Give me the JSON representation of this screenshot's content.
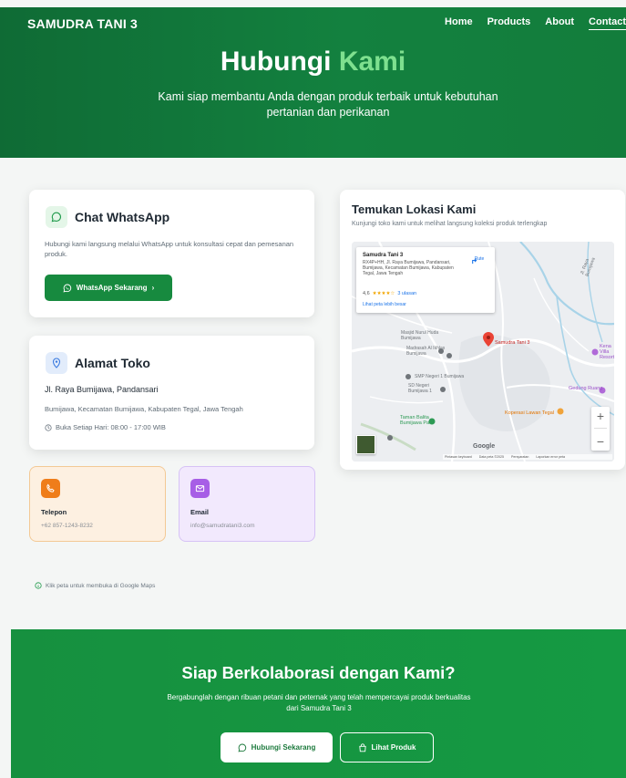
{
  "header": {
    "brand": "SAMUDRA TANI 3",
    "nav": [
      "Home",
      "Products",
      "About",
      "Contact"
    ]
  },
  "hero": {
    "title_main": "Hubungi",
    "title_accent": "Kami",
    "subtitle": "Kami siap membantu Anda dengan produk terbaik untuk kebutuhan pertanian dan perikanan"
  },
  "whatsapp": {
    "title": "Chat WhatsApp",
    "description": "Hubungi kami langsung melalui WhatsApp untuk konsultasi cepat dan pemesanan produk.",
    "button_label": "WhatsApp Sekarang",
    "button_arrow": "›"
  },
  "address": {
    "title": "Alamat Toko",
    "street": "Jl. Raya Bumijawa, Pandansari",
    "region": "Bumijawa, Kecamatan Bumijawa, Kabupaten Tegal, Jawa Tengah",
    "hours": "Buka Setiap Hari: 08:00 - 17:00 WIB"
  },
  "phone": {
    "label": "Telepon",
    "value": "+62 857-1243-8232"
  },
  "email": {
    "label": "Email",
    "value": "info@samudratani3.com"
  },
  "maps_hint": "Klik peta untuk membuka di Google Maps",
  "map_card": {
    "title": "Temukan Lokasi Kami",
    "subtitle": "Kunjungi toko kami untuk melihat langsung koleksi produk terlengkap",
    "popup": {
      "name": "Samudra Tani 3",
      "address": "RX4P+HH, Jl. Raya Bumijawa, Pandansari, Bumijawa, Kecamatan Bumijawa, Kabupaten Tegal, Jawa Tengah",
      "rating": "4,6",
      "stars": "★★★★☆",
      "reviews": "3 ulasan",
      "larger_map": "Lihat peta lebih besar",
      "route": "Rute"
    },
    "labels": {
      "pin": "Samudra Tani 3",
      "masjid": "Masjid Nurul Huda Bumijawa",
      "madrasah": "Madrasah Al Ikhlas Bumijawa",
      "smp": "SMP Negeri 1 Bumijawa",
      "sd": "SD Negeri Bumijawa 1",
      "taman": "Taman Balita Bumijawa Park",
      "koperasi": "Koperasi Lawan Tegal",
      "gedung": "Gedung Ruang",
      "hotel": "Kena Villa Resort",
      "road": "Jl. Raya Bumijawa"
    },
    "zoom_in": "+",
    "zoom_out": "−",
    "google": "Google",
    "attribution": [
      "Pintasan keyboard",
      "Data peta ©2025",
      "Persyaratan",
      "Laporkan error peta"
    ]
  },
  "cta": {
    "title": "Siap Berkolaborasi dengan Kami?",
    "subtitle": "Bergabunglah dengan ribuan petani dan peternak yang telah mempercayai produk berkualitas dari Samudra Tani 3",
    "primary_label": "Hubungi Sekarang",
    "secondary_label": "Lihat Produk"
  }
}
